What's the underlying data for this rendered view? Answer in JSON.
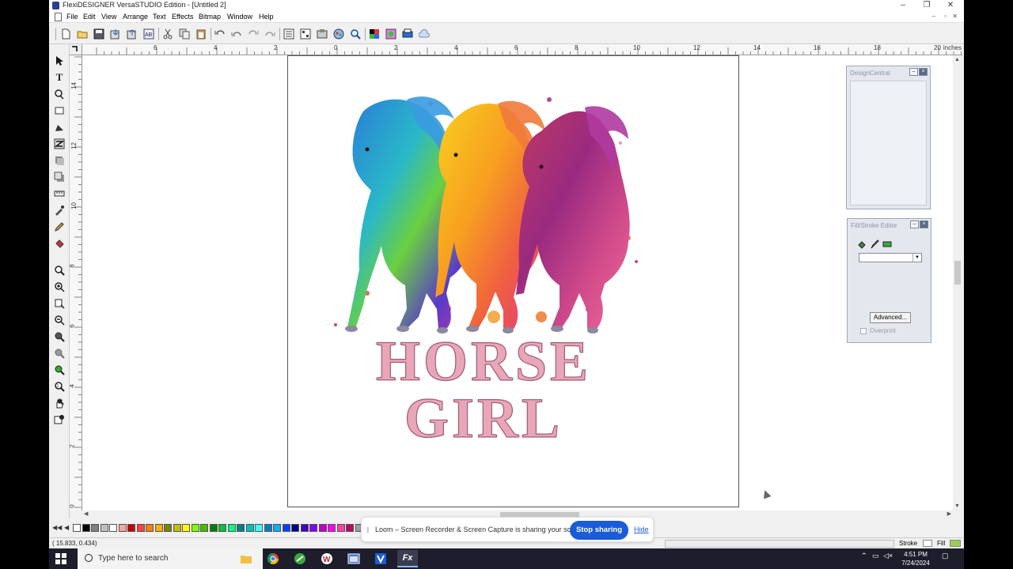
{
  "window": {
    "title": "FlexiDESIGNER VersaSTUDIO Edition - [Untitled 2]"
  },
  "menu": {
    "items": [
      "File",
      "Edit",
      "View",
      "Arrange",
      "Text",
      "Effects",
      "Bitmap",
      "Window",
      "Help"
    ]
  },
  "ruler": {
    "unit": "inches",
    "h_labels": [
      "6",
      "4",
      "2",
      "0",
      "2",
      "4",
      "6",
      "8",
      "10",
      "12",
      "14",
      "16",
      "18",
      "20"
    ],
    "v_labels": [
      "14",
      "12",
      "10",
      "8",
      "6",
      "4",
      "2",
      "0"
    ]
  },
  "artwork": {
    "line1": "HORSE",
    "line2": "GIRL",
    "text_color": "#e8a6b8",
    "stroke_color": "#a05d74"
  },
  "panels": {
    "design_central": {
      "title": "DesignCentral"
    },
    "fill_stroke": {
      "title": "Fill/Stroke Editor",
      "advanced_label": "Advanced...",
      "overprint_label": "Overprint"
    }
  },
  "status": {
    "coords": "( 15.833,    0.434)",
    "stroke_label": "Stroke",
    "fill_label": "Fill"
  },
  "loom": {
    "message": "Loom – Screen Recorder & Screen Capture is sharing your screen.",
    "stop_label": "Stop sharing",
    "hide_label": "Hide",
    "accent": "#1a5cd8"
  },
  "taskbar": {
    "search_placeholder": "Type here to search",
    "time": "4:51 PM",
    "date": "7/24/2024"
  },
  "palette": [
    "#ffffff",
    "#000000",
    "#7f7f7f",
    "#c0c0c0",
    "#ffffff",
    "#f9a3a3",
    "#c80000",
    "#ff4040",
    "#ff8000",
    "#ffb000",
    "#808000",
    "#c0c000",
    "#ffff00",
    "#80ff00",
    "#40c000",
    "#008000",
    "#00c040",
    "#00ff80",
    "#008080",
    "#00c0c0",
    "#40ffff",
    "#0080c0",
    "#00b0ff",
    "#0040ff",
    "#000080",
    "#4000c0",
    "#8000ff",
    "#c000c0",
    "#ff00ff",
    "#ff40a0",
    "#c00060",
    "#a0a0a0",
    "#e0e0e0"
  ]
}
